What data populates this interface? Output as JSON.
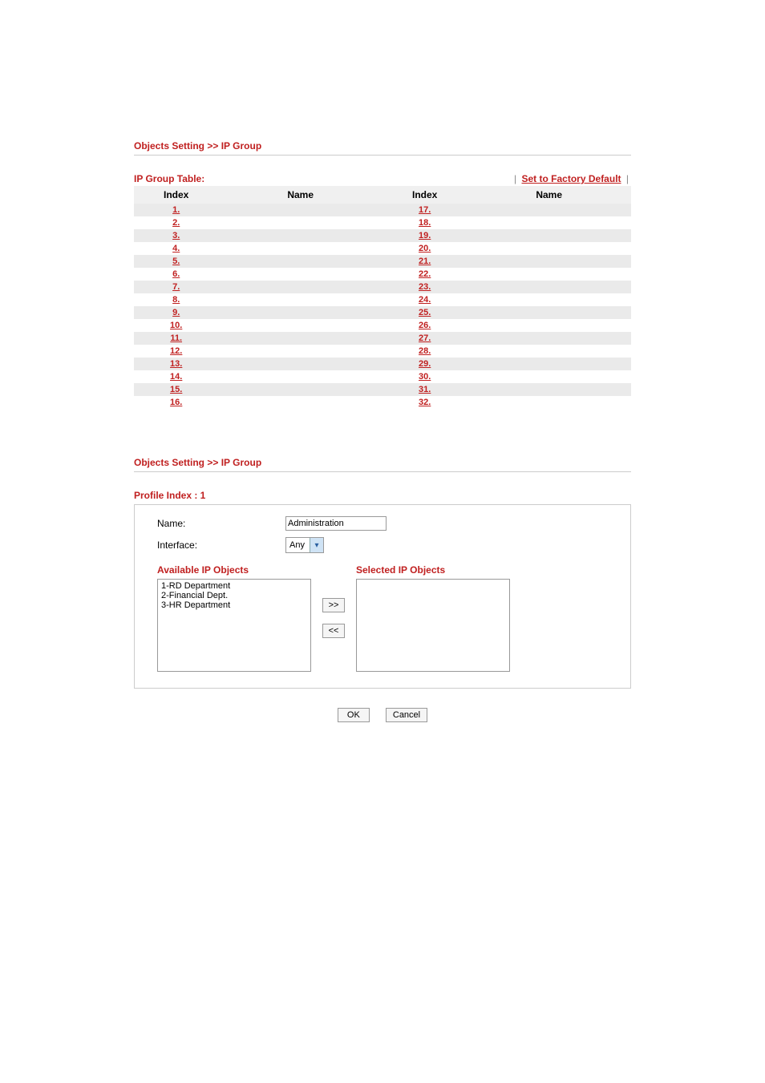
{
  "section1": {
    "title": "Objects Setting >> IP Group",
    "tableLabel": "IP Group Table:",
    "factoryDefault": "Set to Factory Default",
    "headers": {
      "index": "Index",
      "name": "Name"
    },
    "leftStart": 1,
    "rightStart": 17,
    "rows": 16
  },
  "section2": {
    "title": "Objects Setting >> IP Group",
    "profileLabel": "Profile Index : 1",
    "nameLabel": "Name:",
    "nameValue": "Administration",
    "interfaceLabel": "Interface:",
    "interfaceValue": "Any",
    "availableLabel": "Available IP Objects",
    "selectedLabel": "Selected IP Objects",
    "available": [
      "1-RD Department",
      "2-Financial Dept.",
      "3-HR Department"
    ],
    "selected": [],
    "addBtn": ">>",
    "removeBtn": "<<",
    "okBtn": "OK",
    "cancelBtn": "Cancel"
  }
}
